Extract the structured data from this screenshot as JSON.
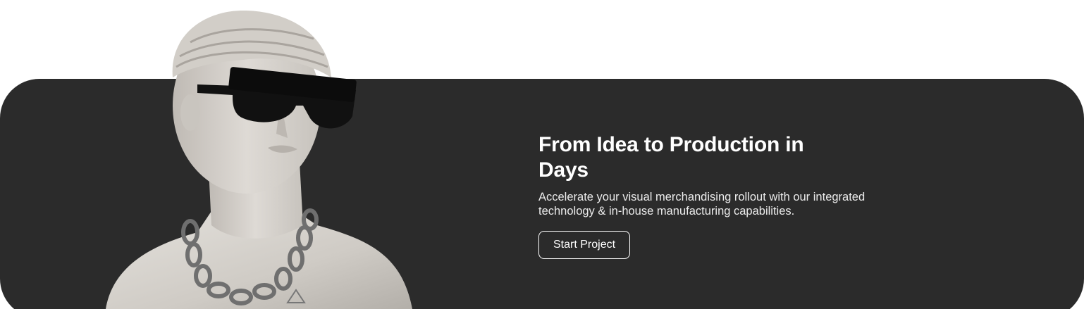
{
  "hero": {
    "headline": "From Idea to Production in Days",
    "subtext": "Accelerate your visual merchandising rollout with our integrated technology & in-house manufacturing capabilities.",
    "cta_label": "Start Project"
  },
  "colors": {
    "banner_background": "#2b2b2b",
    "text": "#ffffff",
    "statue_marble": "#d9d6d1"
  },
  "image": {
    "icon": "marble-statue-with-sunglasses-and-chain"
  }
}
